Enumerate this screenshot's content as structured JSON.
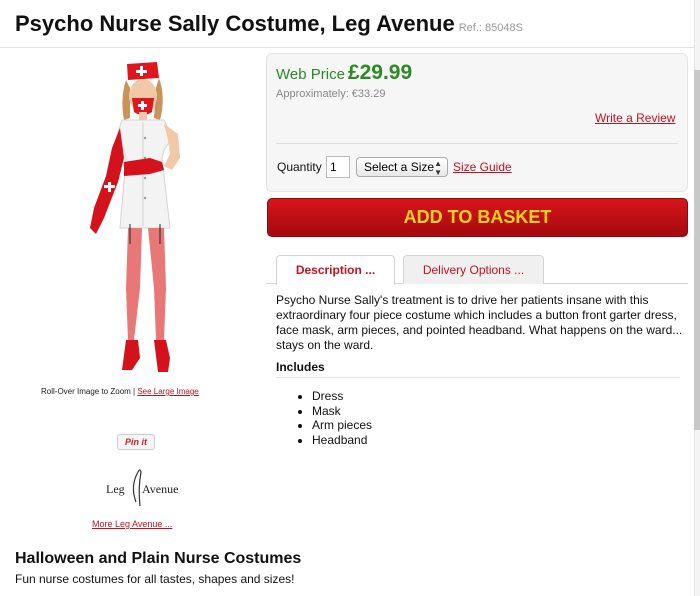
{
  "header": {
    "title": "Psycho Nurse Sally Costume, Leg Avenue",
    "ref": "Ref.: 85048S"
  },
  "gallery": {
    "zoom_hint": "Roll-Over Image to Zoom |",
    "large_image_link": "See Large Image",
    "pin_label": "Pin it",
    "brand_logo": {
      "left_word": "Leg",
      "right_word": "Avenue"
    },
    "more_brand_link": "More Leg Avenue ..."
  },
  "pricing": {
    "web_price_label": "Web Price",
    "web_price_value": "£29.99",
    "approx_label": "Approximately: €33.29",
    "price_color": "#2a8a23"
  },
  "review": {
    "label": "Write a Review"
  },
  "purchase": {
    "quantity_label": "Quantity",
    "quantity_value": "1",
    "size_select_value": "Select a Size",
    "size_guide_label": "Size Guide",
    "add_to_basket_label": "ADD TO BASKET",
    "button_color": "#c3121a",
    "button_text_color": "#ffd21a"
  },
  "tabs": [
    {
      "label": "Description ...",
      "active": true
    },
    {
      "label": "Delivery Options ...",
      "active": false
    }
  ],
  "description": {
    "text": "Psycho Nurse Sally's treatment is to drive her patients insane with this extraordinary four piece costume which includes a button front garter dress, face mask, arm pieces, and pointed headband. What happens on the ward... stays on the ward.",
    "includes_title": "Includes",
    "includes": [
      "Dress",
      "Mask",
      "Arm pieces",
      "Headband"
    ]
  },
  "related": {
    "title": "Halloween and Plain Nurse Costumes",
    "subtitle": "Fun nurse costumes for all tastes, shapes and sizes!"
  },
  "accent_color": "#c1121f"
}
